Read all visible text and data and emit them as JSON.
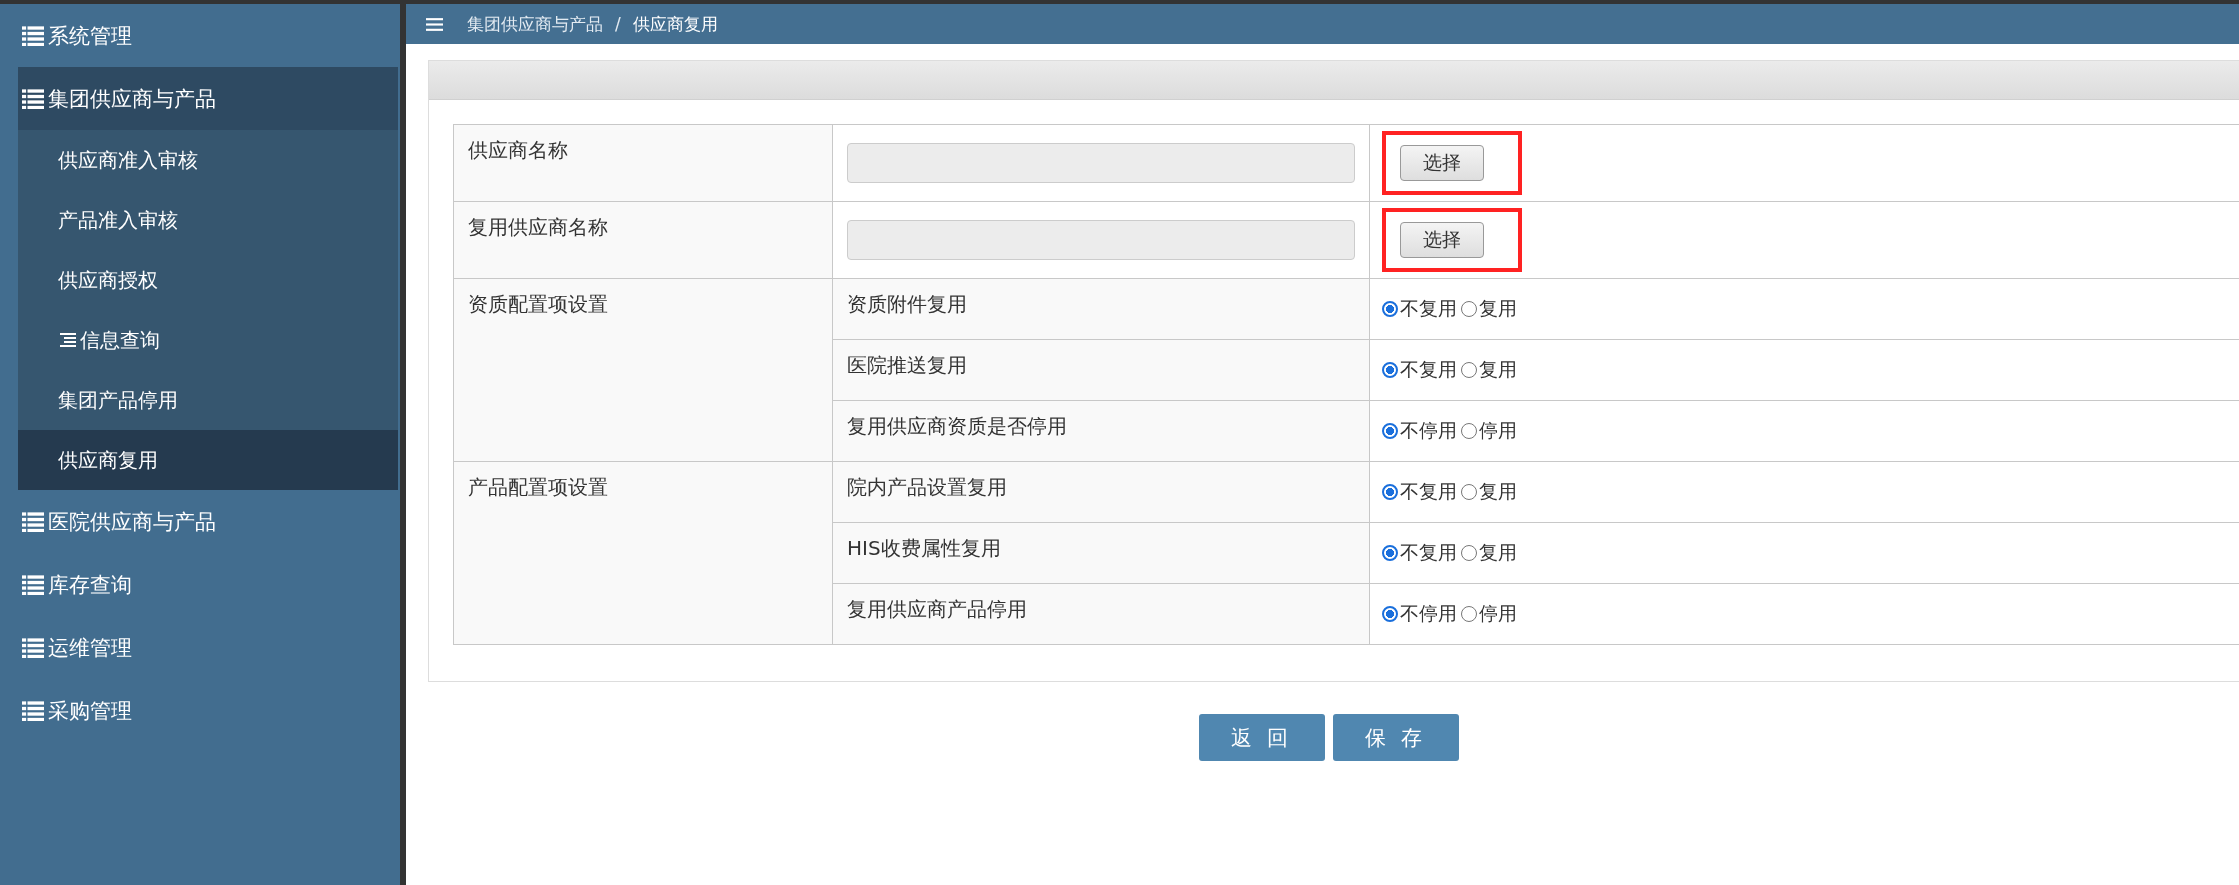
{
  "sidebar": {
    "items": [
      {
        "label": "系统管理",
        "expanded": false
      },
      {
        "label": "集团供应商与产品",
        "expanded": true,
        "children": [
          {
            "label": "供应商准入审核",
            "kind": "plain",
            "selected": false
          },
          {
            "label": "产品准入审核",
            "kind": "plain",
            "selected": false
          },
          {
            "label": "供应商授权",
            "kind": "plain",
            "selected": false
          },
          {
            "label": "信息查询",
            "kind": "iconed",
            "selected": false
          },
          {
            "label": "集团产品停用",
            "kind": "plain",
            "selected": false
          },
          {
            "label": "供应商复用",
            "kind": "plain",
            "selected": true
          }
        ]
      },
      {
        "label": "医院供应商与产品",
        "expanded": false
      },
      {
        "label": "库存查询",
        "expanded": false
      },
      {
        "label": "运维管理",
        "expanded": false
      },
      {
        "label": "采购管理",
        "expanded": false
      }
    ]
  },
  "breadcrumb": {
    "parent": "集团供应商与产品",
    "separator": "/",
    "current": "供应商复用"
  },
  "form": {
    "pickers": [
      {
        "label": "供应商名称",
        "button": "选择",
        "highlighted": true
      },
      {
        "label": "复用供应商名称",
        "button": "选择",
        "highlighted": true
      }
    ],
    "groups": [
      {
        "label": "资质配置项设置",
        "rows": [
          {
            "label": "资质附件复用",
            "options": [
              {
                "label": "不复用",
                "selected": true
              },
              {
                "label": "复用",
                "selected": false
              }
            ]
          },
          {
            "label": "医院推送复用",
            "options": [
              {
                "label": "不复用",
                "selected": true
              },
              {
                "label": "复用",
                "selected": false
              }
            ]
          },
          {
            "label": "复用供应商资质是否停用",
            "options": [
              {
                "label": "不停用",
                "selected": true
              },
              {
                "label": "停用",
                "selected": false
              }
            ]
          }
        ]
      },
      {
        "label": "产品配置项设置",
        "rows": [
          {
            "label": "院内产品设置复用",
            "options": [
              {
                "label": "不复用",
                "selected": true
              },
              {
                "label": "复用",
                "selected": false
              }
            ]
          },
          {
            "label": "HIS收费属性复用",
            "options": [
              {
                "label": "不复用",
                "selected": true
              },
              {
                "label": "复用",
                "selected": false
              }
            ]
          },
          {
            "label": "复用供应商产品停用",
            "options": [
              {
                "label": "不停用",
                "selected": true
              },
              {
                "label": "停用",
                "selected": false
              }
            ]
          }
        ]
      }
    ]
  },
  "actions": [
    "返 回",
    "保 存"
  ]
}
